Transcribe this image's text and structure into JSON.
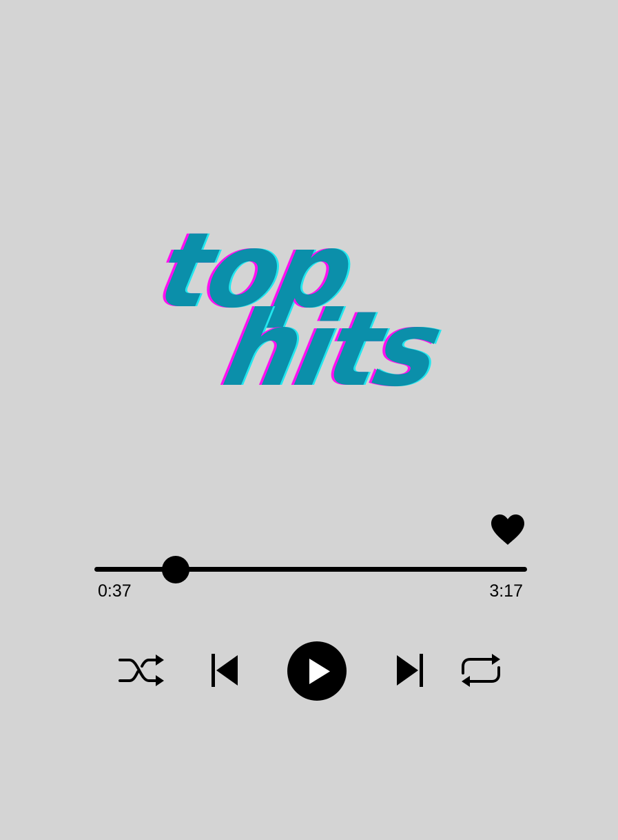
{
  "logo": {
    "line1": "top",
    "line2": "hits",
    "colors": {
      "main": "#0b8faa",
      "shadow_left": "#ff10f0",
      "shadow_right": "#22e6ee"
    }
  },
  "player": {
    "elapsed": "0:37",
    "duration": "3:17",
    "progress_fraction": 0.188,
    "liked": true
  },
  "controls": {
    "shuffle_icon": "shuffle-icon",
    "previous_icon": "skip-previous-icon",
    "play_icon": "play-icon",
    "next_icon": "skip-next-icon",
    "repeat_icon": "repeat-icon",
    "like_icon": "heart-icon"
  },
  "colors": {
    "background": "#d4d4d4",
    "foreground": "#000000"
  }
}
